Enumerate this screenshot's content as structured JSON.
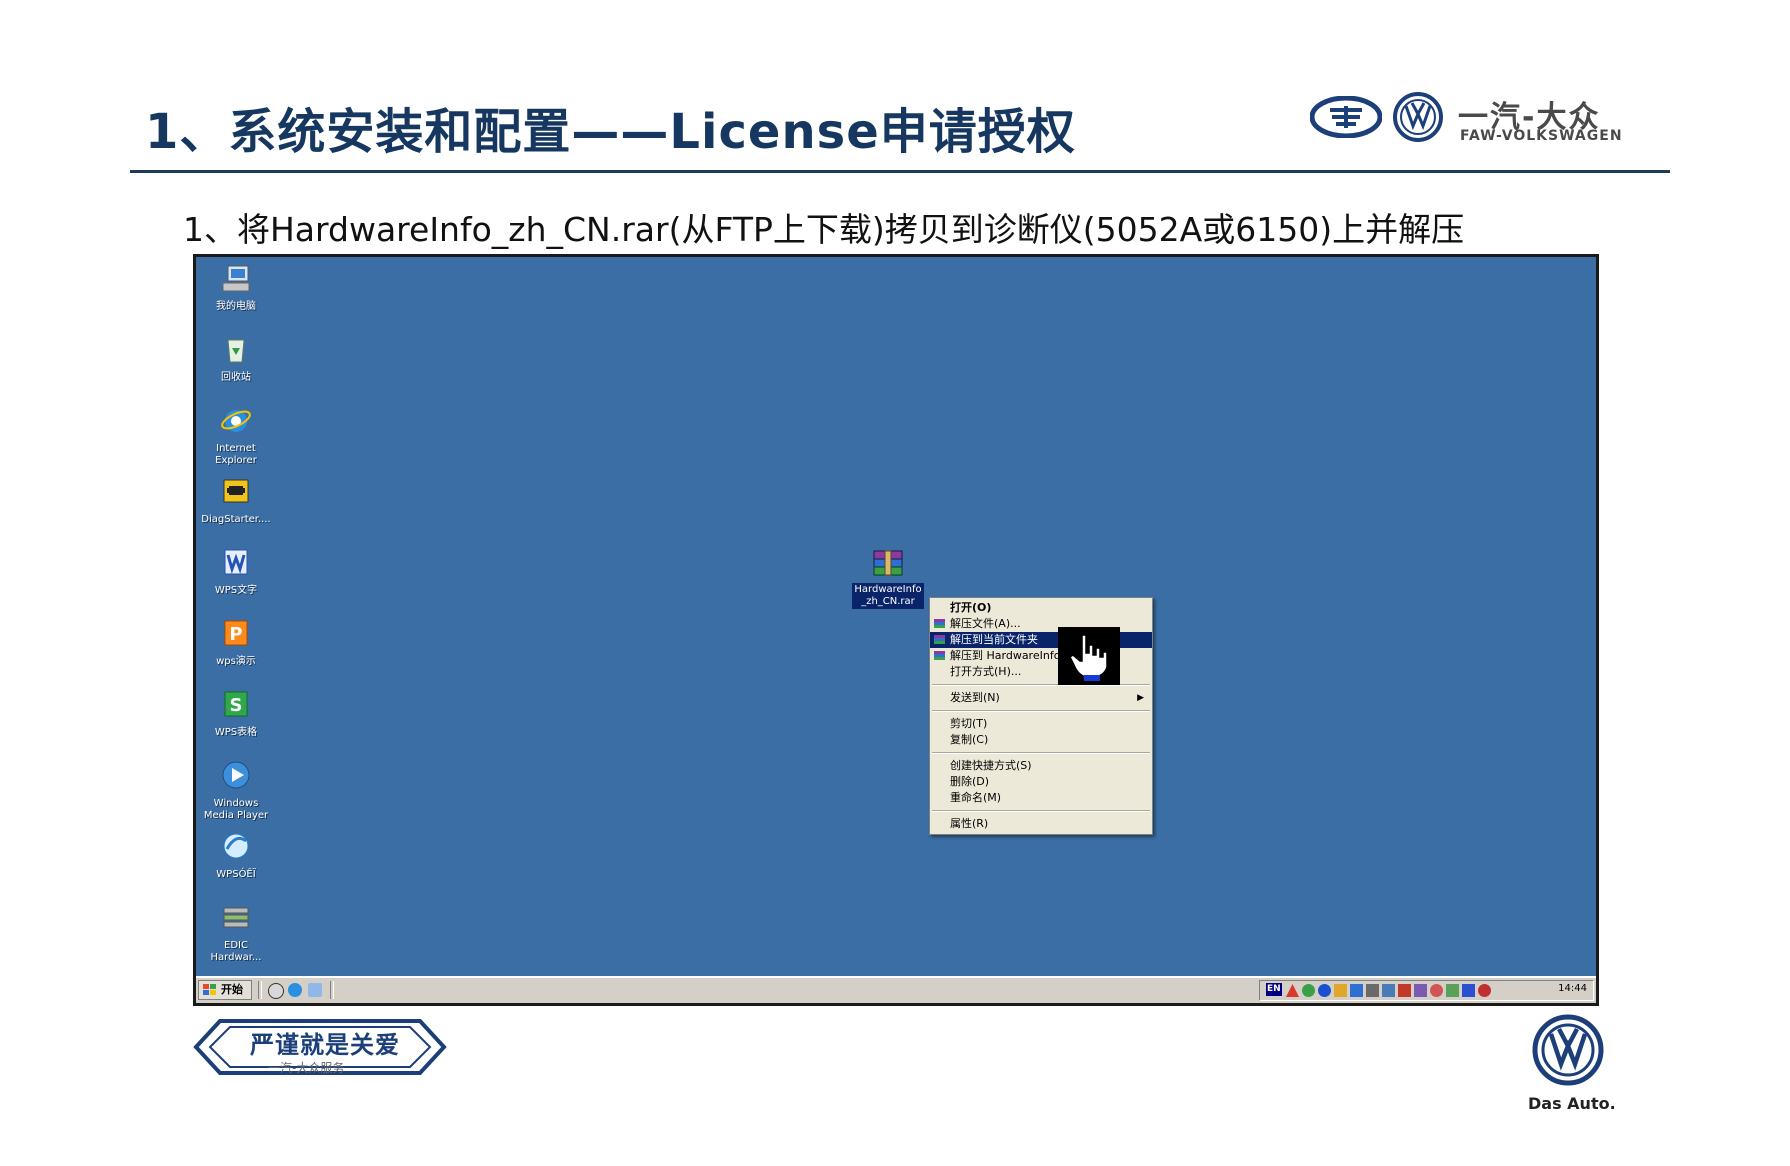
{
  "slide": {
    "title": "1、系统安装和配置——License申请授权",
    "subtitle": "1、将HardwareInfo_zh_CN.rar(从FTP上下载)拷贝到诊断仪(5052A或6150)上并解压"
  },
  "brand": {
    "name_cn": "一汽-大众",
    "name_en": "FAW-VOLKSWAGEN"
  },
  "desktop": {
    "background_color": "#3a6ea5",
    "icons": [
      {
        "label": "我的电脑",
        "icon": "my-computer-icon"
      },
      {
        "label": "回收站",
        "icon": "recycle-bin-icon"
      },
      {
        "label": "Internet\nExplorer",
        "icon": "internet-explorer-icon"
      },
      {
        "label": "DiagStarter....",
        "icon": "diagstarter-icon"
      },
      {
        "label": "WPS文字",
        "icon": "wps-writer-icon"
      },
      {
        "label": "wps演示",
        "icon": "wps-presentation-icon"
      },
      {
        "label": "WPS表格",
        "icon": "wps-spreadsheet-icon"
      },
      {
        "label": "Windows\nMedia Player",
        "icon": "media-player-icon"
      },
      {
        "label": "WPSÓÊÏ",
        "icon": "wps-mail-icon"
      },
      {
        "label": "EDIC\nHardwar...",
        "icon": "edic-hardware-icon"
      }
    ],
    "file": {
      "label": "HardwareInfo\n_zh_CN.rar",
      "icon": "winrar-archive-icon"
    }
  },
  "context_menu": {
    "items": [
      {
        "label": "打开(O)"
      },
      {
        "label": "解压文件(A)..."
      },
      {
        "label": "解压到当前文件夹"
      },
      {
        "label": "解压到 HardwareInfo_zh_CN\\(E)"
      },
      {
        "label": "打开方式(H)..."
      },
      {
        "label": "发送到(N)"
      },
      {
        "label": "剪切(T)"
      },
      {
        "label": "复制(C)"
      },
      {
        "label": "创建快捷方式(S)"
      },
      {
        "label": "删除(D)"
      },
      {
        "label": "重命名(M)"
      },
      {
        "label": "属性(R)"
      }
    ],
    "highlight_color": "#0a246a"
  },
  "taskbar": {
    "start_label": "开始",
    "lang": "EN",
    "clock": "14:44"
  },
  "footer": {
    "badge_text": "严谨就是关爱",
    "badge_sub": "一汽-大众服务",
    "tagline": "Das Auto."
  }
}
